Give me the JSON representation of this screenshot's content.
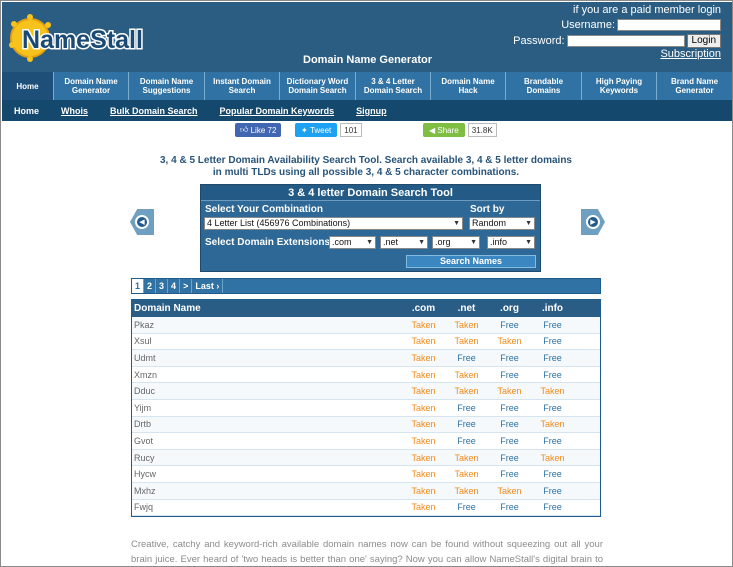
{
  "header": {
    "logo_text": "NameStall",
    "login_notice": "if you are a paid member login",
    "username_label": "Username:",
    "password_label": "Password:",
    "login_button": "Login",
    "subscription_link": "Subscription",
    "page_heading": "Domain Name Generator"
  },
  "nav": [
    {
      "label": "Home",
      "active": true
    },
    {
      "label": "Domain Name Generator"
    },
    {
      "label": "Domain Name Suggestions"
    },
    {
      "label": "Instant Domain Search"
    },
    {
      "label": "Dictionary Word Domain Search"
    },
    {
      "label": "3 & 4 Letter Domain Search"
    },
    {
      "label": "Domain Name Hack"
    },
    {
      "label": "Brandable Domains"
    },
    {
      "label": "High Paying Keywords"
    },
    {
      "label": "Brand Name Generator"
    }
  ],
  "subnav": [
    "Home",
    "Whois",
    "Bulk Domain Search",
    "Popular Domain Keywords",
    "Signup"
  ],
  "social": {
    "fb_label": "Like 72",
    "tw_label": "Tweet",
    "tw_count": "101",
    "share_label": "Share",
    "share_count": "31.8K"
  },
  "intro": {
    "line1": "3, 4 & 5 Letter Domain Availability Search Tool. Search available 3, 4 & 5 letter domains",
    "line2": "in multi TLDs using all possible 3, 4 & 5 character combinations."
  },
  "tool": {
    "title": "3 & 4 letter Domain Search Tool",
    "combination_label": "Select Your Combination",
    "combination_value": "4 Letter List (456976 Combinations)",
    "sort_label": "Sort by",
    "sort_value": "Random",
    "ext_label": "Select Domain Extensions:",
    "ext_values": [
      ".com",
      ".net",
      ".org",
      ".info"
    ],
    "search_button": "Search Names"
  },
  "pager": [
    "1",
    "2",
    "3",
    "4",
    ">",
    "Last ›"
  ],
  "table": {
    "headers": [
      "Domain Name",
      ".com",
      ".net",
      ".org",
      ".info"
    ],
    "rows": [
      [
        "Pkaz",
        "Taken",
        "Taken",
        "Free",
        "Free"
      ],
      [
        "Xsul",
        "Taken",
        "Taken",
        "Taken",
        "Free"
      ],
      [
        "Udmt",
        "Taken",
        "Free",
        "Free",
        "Free"
      ],
      [
        "Xmzn",
        "Taken",
        "Taken",
        "Free",
        "Free"
      ],
      [
        "Dduc",
        "Taken",
        "Taken",
        "Taken",
        "Taken"
      ],
      [
        "Yijm",
        "Taken",
        "Free",
        "Free",
        "Free"
      ],
      [
        "Drtb",
        "Taken",
        "Free",
        "Free",
        "Taken"
      ],
      [
        "Gvot",
        "Taken",
        "Free",
        "Free",
        "Free"
      ],
      [
        "Rucy",
        "Taken",
        "Taken",
        "Free",
        "Taken"
      ],
      [
        "Hycw",
        "Taken",
        "Taken",
        "Free",
        "Free"
      ],
      [
        "Mxhz",
        "Taken",
        "Taken",
        "Taken",
        "Free"
      ],
      [
        "Fwjq",
        "Taken",
        "Free",
        "Free",
        "Free"
      ]
    ]
  },
  "body_text": "Creative, catchy and keyword-rich available domain names now can be found without squeezing out all your brain juice. Ever heard of 'two heads is better than one' saying? Now you can allow NameStall's digital brain to help"
}
